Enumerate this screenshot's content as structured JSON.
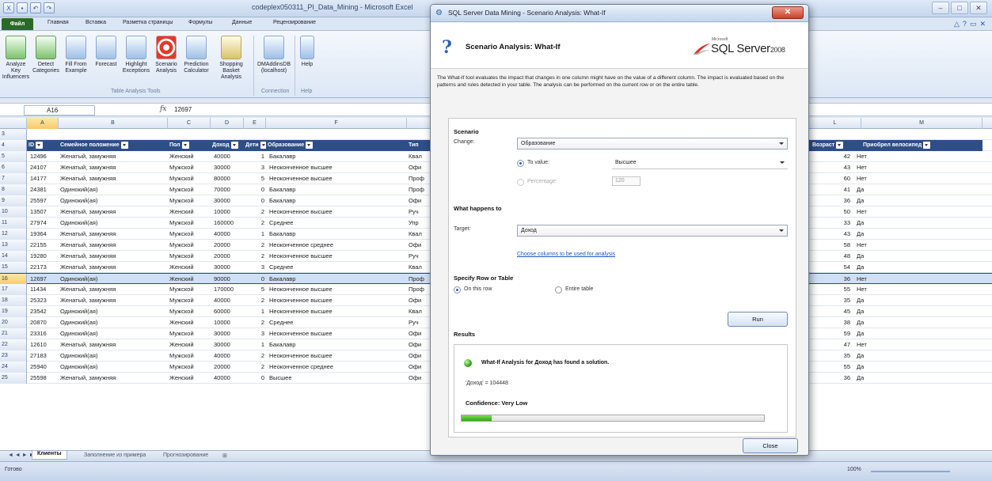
{
  "excel": {
    "title": "codeplex050311_PI_Data_Mining - Microsoft Excel",
    "file_tab": "Файл",
    "tabs": [
      "Главная",
      "Вставка",
      "Разметка страницы",
      "Формулы",
      "Данные",
      "Рецензирование"
    ],
    "ribbon_buttons": [
      {
        "label": "Analyze Key Influencers",
        "icon": "chart-icon"
      },
      {
        "label": "Detect Categories",
        "icon": "category-icon"
      },
      {
        "label": "Fill From Example",
        "icon": "table-icon"
      },
      {
        "label": "Forecast",
        "icon": "forecast-icon"
      },
      {
        "label": "Highlight Exceptions",
        "icon": "highlight-icon"
      },
      {
        "label": "Scenario Analysis",
        "icon": "target-icon"
      },
      {
        "label": "Prediction Calculator",
        "icon": "calculator-icon"
      },
      {
        "label": "Shopping Basket Analysis",
        "icon": "basket-icon"
      },
      {
        "label": "DMAddinsDB (localhost)",
        "icon": "connection-icon"
      },
      {
        "label": "Help",
        "icon": "help-icon"
      }
    ],
    "ribbon_groups": [
      "Table Analysis Tools",
      "Connection",
      "Help"
    ],
    "name_box": "A16",
    "formula_value": "12697",
    "columns": [
      "A",
      "B",
      "C",
      "D",
      "E",
      "F",
      "L",
      "M"
    ],
    "table_headers": [
      "ID",
      "Семейное положение",
      "Пол",
      "Доход",
      "Дети",
      "Образование",
      "Тип",
      "Возраст",
      "Приобрел велосипед"
    ],
    "rows": [
      {
        "n": "5",
        "id": "12496",
        "marital": "Женатый, замужняя",
        "sex": "Женский",
        "income": "40000",
        "kids": "1",
        "edu": "Бакалавр",
        "type": "Квал",
        "age": "42",
        "bought": "Нет"
      },
      {
        "n": "6",
        "id": "24107",
        "marital": "Женатый, замужняя",
        "sex": "Мужской",
        "income": "30000",
        "kids": "3",
        "edu": "Неоконченное высшее",
        "type": "Офи",
        "age": "43",
        "bought": "Нет"
      },
      {
        "n": "7",
        "id": "14177",
        "marital": "Женатый, замужняя",
        "sex": "Мужской",
        "income": "80000",
        "kids": "5",
        "edu": "Неоконченное высшее",
        "type": "Проф",
        "age": "60",
        "bought": "Нет"
      },
      {
        "n": "8",
        "id": "24381",
        "marital": "Одинокий(ая)",
        "sex": "Мужской",
        "income": "70000",
        "kids": "0",
        "edu": "Бакалавр",
        "type": "Проф",
        "age": "41",
        "bought": "Да"
      },
      {
        "n": "9",
        "id": "25597",
        "marital": "Одинокий(ая)",
        "sex": "Мужской",
        "income": "30000",
        "kids": "0",
        "edu": "Бакалавр",
        "type": "Офи",
        "age": "36",
        "bought": "Да"
      },
      {
        "n": "10",
        "id": "13507",
        "marital": "Женатый, замужняя",
        "sex": "Женский",
        "income": "10000",
        "kids": "2",
        "edu": "Неоконченное высшее",
        "type": "Руч",
        "age": "50",
        "bought": "Нет"
      },
      {
        "n": "11",
        "id": "27974",
        "marital": "Одинокий(ая)",
        "sex": "Мужской",
        "income": "160000",
        "kids": "2",
        "edu": "Среднее",
        "type": "Упр",
        "age": "33",
        "bought": "Да"
      },
      {
        "n": "12",
        "id": "19364",
        "marital": "Женатый, замужняя",
        "sex": "Мужской",
        "income": "40000",
        "kids": "1",
        "edu": "Бакалавр",
        "type": "Квал",
        "age": "43",
        "bought": "Да"
      },
      {
        "n": "13",
        "id": "22155",
        "marital": "Женатый, замужняя",
        "sex": "Мужской",
        "income": "20000",
        "kids": "2",
        "edu": "Неоконченное среднее",
        "type": "Офи",
        "age": "58",
        "bought": "Нет"
      },
      {
        "n": "14",
        "id": "19280",
        "marital": "Женатый, замужняя",
        "sex": "Мужской",
        "income": "20000",
        "kids": "2",
        "edu": "Неоконченное высшее",
        "type": "Руч",
        "age": "48",
        "bought": "Да"
      },
      {
        "n": "15",
        "id": "22173",
        "marital": "Женатый, замужняя",
        "sex": "Женский",
        "income": "30000",
        "kids": "3",
        "edu": "Среднее",
        "type": "Квал",
        "age": "54",
        "bought": "Да"
      },
      {
        "n": "16",
        "id": "12697",
        "marital": "Одинокий(ая)",
        "sex": "Женский",
        "income": "90000",
        "kids": "0",
        "edu": "Бакалавр",
        "type": "Проф",
        "age": "36",
        "bought": "Нет"
      },
      {
        "n": "17",
        "id": "11434",
        "marital": "Женатый, замужняя",
        "sex": "Мужской",
        "income": "170000",
        "kids": "5",
        "edu": "Неоконченное высшее",
        "type": "Проф",
        "age": "55",
        "bought": "Нет"
      },
      {
        "n": "18",
        "id": "25323",
        "marital": "Женатый, замужняя",
        "sex": "Мужской",
        "income": "40000",
        "kids": "2",
        "edu": "Неоконченное высшее",
        "type": "Офи",
        "age": "35",
        "bought": "Да"
      },
      {
        "n": "19",
        "id": "23542",
        "marital": "Одинокий(ая)",
        "sex": "Мужской",
        "income": "60000",
        "kids": "1",
        "edu": "Неоконченное высшее",
        "type": "Квал",
        "age": "45",
        "bought": "Да"
      },
      {
        "n": "20",
        "id": "20870",
        "marital": "Одинокий(ая)",
        "sex": "Женский",
        "income": "10000",
        "kids": "2",
        "edu": "Среднее",
        "type": "Руч",
        "age": "38",
        "bought": "Да"
      },
      {
        "n": "21",
        "id": "23316",
        "marital": "Одинокий(ая)",
        "sex": "Мужской",
        "income": "30000",
        "kids": "3",
        "edu": "Неоконченное высшее",
        "type": "Офи",
        "age": "59",
        "bought": "Да"
      },
      {
        "n": "22",
        "id": "12610",
        "marital": "Женатый, замужняя",
        "sex": "Женский",
        "income": "30000",
        "kids": "1",
        "edu": "Бакалавр",
        "type": "Офи",
        "age": "47",
        "bought": "Нет"
      },
      {
        "n": "23",
        "id": "27183",
        "marital": "Одинокий(ая)",
        "sex": "Мужской",
        "income": "40000",
        "kids": "2",
        "edu": "Неоконченное высшее",
        "type": "Офи",
        "age": "35",
        "bought": "Да"
      },
      {
        "n": "24",
        "id": "25940",
        "marital": "Одинокий(ая)",
        "sex": "Мужской",
        "income": "20000",
        "kids": "2",
        "edu": "Неоконченное среднее",
        "type": "Офи",
        "age": "55",
        "bought": "Да"
      },
      {
        "n": "25",
        "id": "25598",
        "marital": "Женатый, замужняя",
        "sex": "Женский",
        "income": "40000",
        "kids": "0",
        "edu": "Высшее",
        "type": "Офи",
        "age": "36",
        "bought": "Да"
      }
    ],
    "sheets": [
      "Клиенты",
      "Заполнение из примера",
      "Прогнозирование"
    ],
    "status_text": "Готово",
    "zoom": "100%"
  },
  "dialog": {
    "window_title": "SQL Server Data Mining - Scenario Analysis: What-If",
    "close_x": "✕",
    "heading": "Scenario Analysis: What-If",
    "logo_small": "Microsoft",
    "logo_text": "SQL Server",
    "logo_version": "2008",
    "description": "The What-If tool evaluates the impact that changes in one column might have on the value of a different column. The impact is evaluated based on the patterns and rules detected in your table. The analysis can be performed on the current row or on the entire table.",
    "scenario_label": "Scenario",
    "change_label": "Change:",
    "change_value": "Образование",
    "to_value_label": "To value:",
    "to_value_value": "Высшее",
    "percentage_label": "Percentage:",
    "percentage_value": "120",
    "what_happens_label": "What happens to",
    "target_label": "Target:",
    "target_value": "Доход",
    "choose_columns_link": "Choose columns to be used for analysis",
    "specify_label": "Specify Row or Table",
    "on_this_row": "On this row",
    "entire_table": "Entire table",
    "run_button": "Run",
    "results_label": "Results",
    "result_title": "What-If Analysis for Доход has found a solution.",
    "result_value": "'Доход' = 104448",
    "confidence": "Confidence: Very Low",
    "confidence_level": 0.1,
    "close_button": "Close"
  }
}
